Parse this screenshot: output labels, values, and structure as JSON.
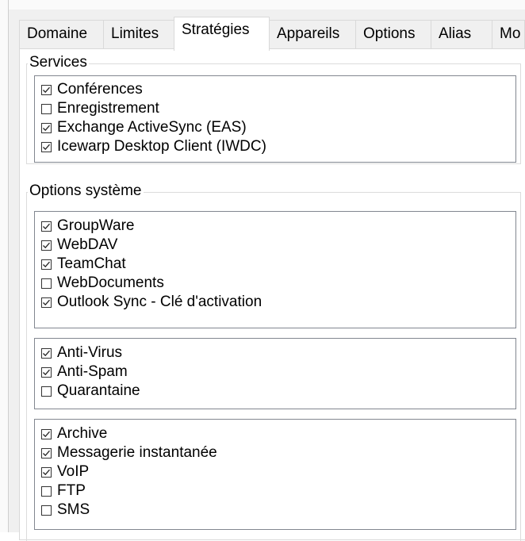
{
  "tabs": [
    {
      "label": "Domaine",
      "active": false
    },
    {
      "label": "Limites",
      "active": false
    },
    {
      "label": "Stratégies",
      "active": true
    },
    {
      "label": "Appareils",
      "active": false
    },
    {
      "label": "Options",
      "active": false
    },
    {
      "label": "Alias",
      "active": false
    },
    {
      "label": "Mo",
      "active": false
    }
  ],
  "services": {
    "legend": "Services",
    "items": [
      {
        "label": "Conférences",
        "checked": true
      },
      {
        "label": "Enregistrement",
        "checked": false
      },
      {
        "label": "Exchange ActiveSync (EAS)",
        "checked": true
      },
      {
        "label": "Icewarp Desktop Client (IWDC)",
        "checked": true
      }
    ]
  },
  "options_systeme": {
    "legend": "Options système",
    "group1": [
      {
        "label": "GroupWare",
        "checked": true
      },
      {
        "label": "WebDAV",
        "checked": true
      },
      {
        "label": "TeamChat",
        "checked": true
      },
      {
        "label": "WebDocuments",
        "checked": false
      },
      {
        "label": "Outlook Sync - Clé d'activation",
        "checked": true
      }
    ],
    "group2": [
      {
        "label": "Anti-Virus",
        "checked": true
      },
      {
        "label": "Anti-Spam",
        "checked": true
      },
      {
        "label": "Quarantaine",
        "checked": false
      }
    ],
    "group3": [
      {
        "label": "Archive",
        "checked": true
      },
      {
        "label": "Messagerie instantanée",
        "checked": true
      },
      {
        "label": "VoIP",
        "checked": true
      },
      {
        "label": "FTP",
        "checked": false
      },
      {
        "label": "SMS",
        "checked": false
      }
    ]
  },
  "icons": {
    "checked": "checkmark-icon"
  }
}
